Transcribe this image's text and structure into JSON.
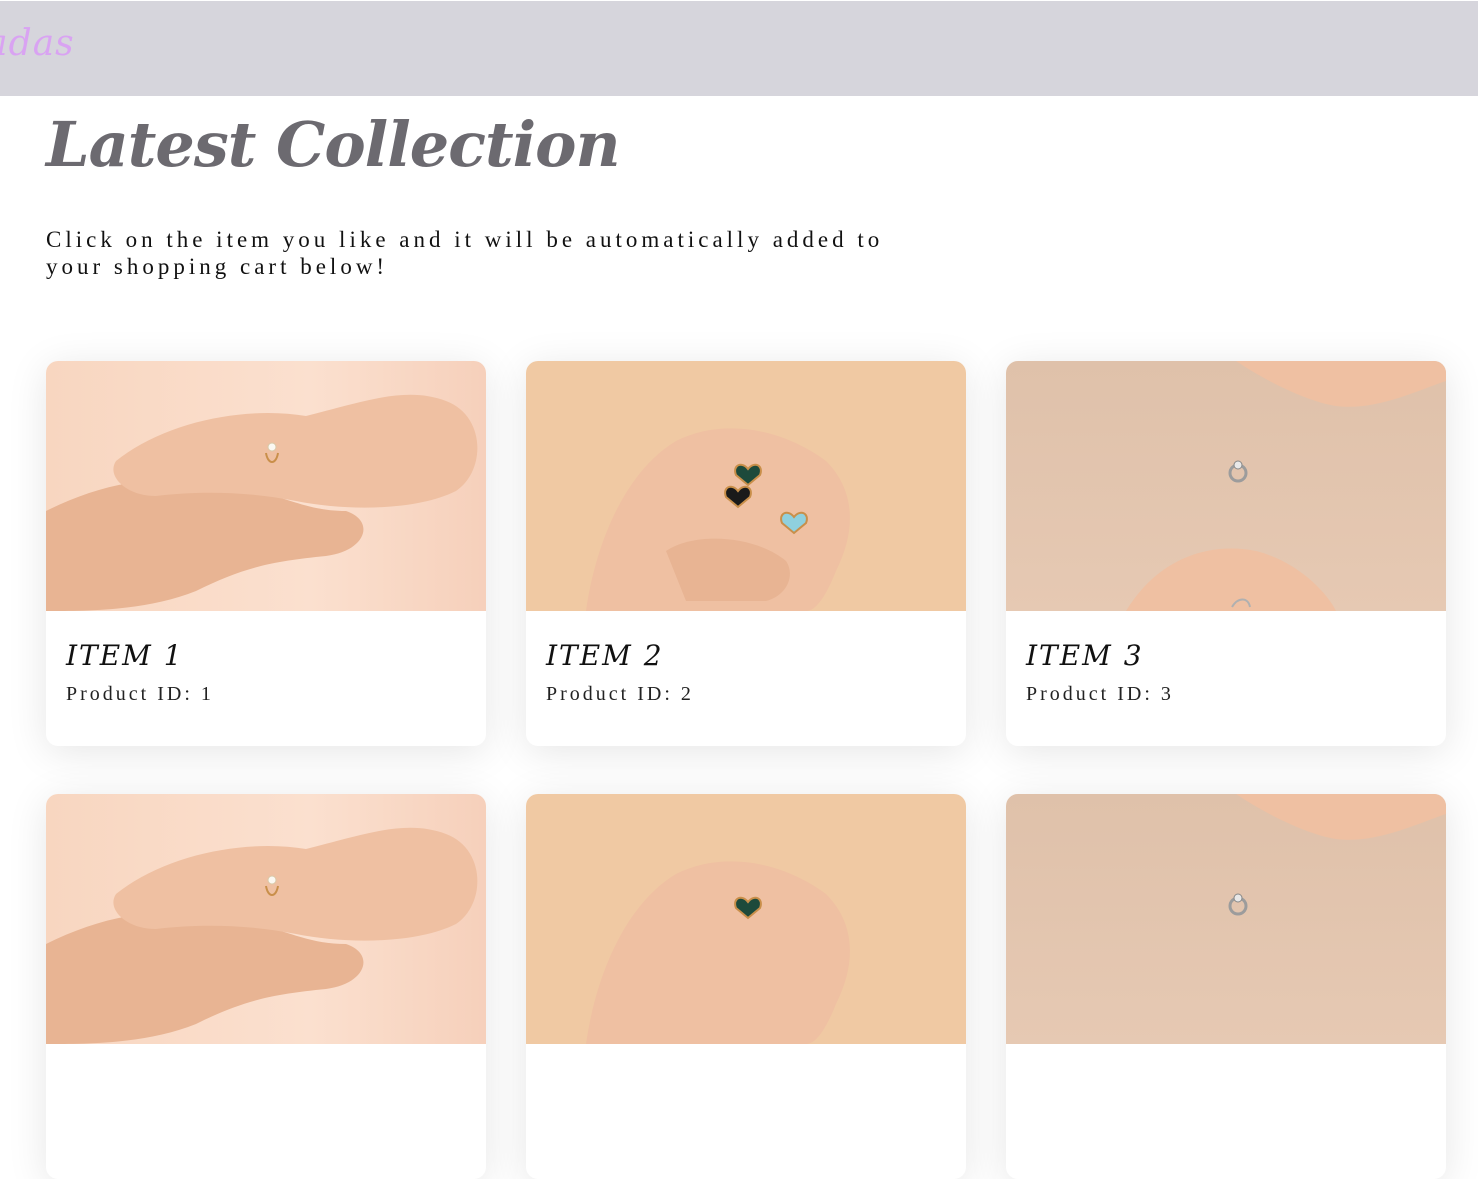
{
  "header": {
    "brand": "nadas",
    "background_color": "#d6d5dc",
    "brand_color": "#d9a3f2"
  },
  "main": {
    "title": "Latest Collection",
    "intro": "Click on the item you like and it will be automatically added to your shopping cart below!"
  },
  "products": [
    {
      "name": "ITEM 1",
      "id_label": "Product ID: 1",
      "image": "hands-diamond-ring-photo"
    },
    {
      "name": "ITEM 2",
      "id_label": "Product ID: 2",
      "image": "hand-heart-rings-photo"
    },
    {
      "name": "ITEM 3",
      "id_label": "Product ID: 3",
      "image": "hands-silver-ring-photo"
    },
    {
      "name": "",
      "id_label": "",
      "image": "hands-diamond-ring-photo"
    },
    {
      "name": "",
      "id_label": "",
      "image": "hand-heart-rings-photo"
    },
    {
      "name": "",
      "id_label": "",
      "image": "hands-silver-ring-photo"
    }
  ]
}
